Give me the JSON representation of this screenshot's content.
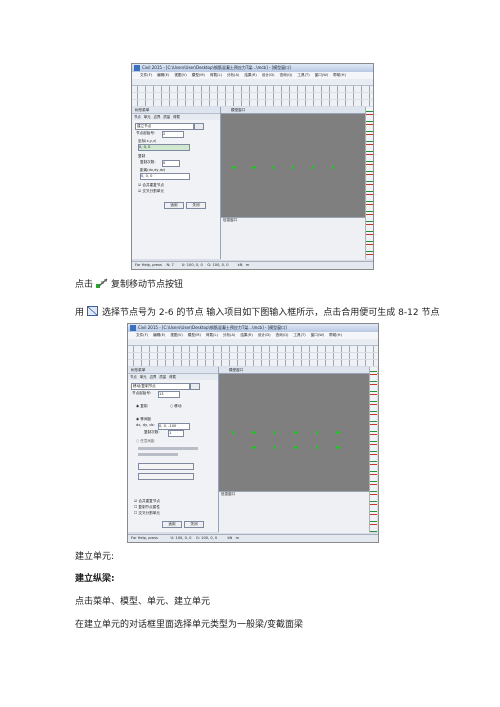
{
  "screenshot1": {
    "window_title": "Civil 2015 - [C:\\Users\\User\\Desktop\\钢筋混凝土预应力T梁...\\mcb] - [模型窗口]",
    "menu": [
      "文件(F)",
      "编辑(E)",
      "视图(V)",
      "模型(M)",
      "荷载(L)",
      "分析(A)",
      "结果(R)",
      "设计(D)",
      "查询(Q)",
      "工具(T)",
      "窗口(W)",
      "帮助(H)"
    ],
    "panel_title": "树形菜单",
    "panel_tabs": [
      "节点",
      "单元",
      "边界",
      "质量",
      "荷载"
    ],
    "dropdown_value": "建立节点",
    "field_node_number_label": "节点起始号:",
    "field_node_number_value": "2",
    "field_coord_label": "坐标(x,y,z)",
    "field_coord_value": "0, 0, 0",
    "field_copy_label": "复制",
    "field_copy_count_label": "复制次数:",
    "field_copy_count_value": "0",
    "field_distance_label": "距离(dx,dy,dz)",
    "field_distance_value": "0, 0, 0",
    "check_merge": "合并重复节点",
    "check_intersect": "交叉分割单元",
    "button_apply": "适用",
    "button_close": "关闭",
    "canvas_tab": "模型窗口",
    "message_tab": "信息窗口",
    "status_help": "For Help, press",
    "status_node": "N: 7",
    "status_coord": "U: 100, 0, 0",
    "status_g": "G: 100, 0, 0",
    "status_unit_force": "kN",
    "status_unit_length": "m"
  },
  "caption1": {
    "prefix": "点击",
    "suffix": "复制移动节点按钮"
  },
  "caption2": {
    "prefix": "用",
    "text": "选择节点号为 2-6 的节点  输入项目如下图输入框所示，点击合用便可生成 8-12 节点"
  },
  "screenshot2": {
    "window_title": "Civil 2015 - [C:\\Users\\User\\Desktop\\钢筋混凝土预应力T梁...\\mcb] - [模型窗口]",
    "menu": [
      "文件(F)",
      "编辑(E)",
      "视图(V)",
      "模型(M)",
      "荷载(L)",
      "分析(A)",
      "结果(R)",
      "设计(D)",
      "查询(Q)",
      "工具(T)",
      "窗口(W)",
      "帮助(H)"
    ],
    "panel_title": "树形菜单",
    "panel_tabs": [
      "节点",
      "单元",
      "边界",
      "质量",
      "荷载"
    ],
    "dropdown_value": "移动/复制节点",
    "field_node_number_label": "节点起始号:",
    "field_node_number_value": "13",
    "mode_copy": "复制",
    "mode_move": "移动",
    "move_type_label": "等间距",
    "field_distance_label": "dx, dy, dz:",
    "field_distance_value": "0, 0, -100",
    "field_copy_count_label": "复制次数:",
    "field_copy_count_value": "1",
    "field_unequal": "任意间距",
    "check_merge": "合并重复节点",
    "check_copy_attr": "复制节点属性",
    "check_intersect": "交叉分割单元",
    "button_apply": "适用",
    "button_close": "关闭",
    "canvas_tab": "模型窗口",
    "message_tab": "信息窗口",
    "status_help": "For Help, press",
    "status_coord": "U: 100, 0, 0",
    "status_g": "G: 100, 0, 0",
    "status_unit_force": "kN",
    "status_unit_length": "m"
  },
  "section": {
    "create_element": "建立单元:",
    "create_beam": "建立纵梁:",
    "step1": "点击菜单、模型、单元、建立单元",
    "step2": "在建立单元的对话框里面选择单元类型为一般梁/变截面梁"
  }
}
